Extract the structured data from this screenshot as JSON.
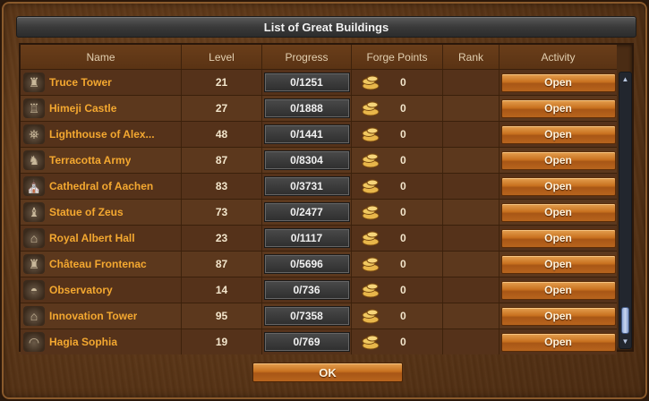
{
  "dialog": {
    "title": "List of Great Buildings",
    "ok_label": "OK"
  },
  "columns": {
    "name": "Name",
    "level": "Level",
    "progress": "Progress",
    "forge_points": "Forge Points",
    "rank": "Rank",
    "activity": "Activity"
  },
  "buildings": [
    {
      "name": "Truce Tower",
      "level": "21",
      "progress": "0/1251",
      "forge_points": "0",
      "rank": "",
      "action": "Open",
      "icon": "tower-icon"
    },
    {
      "name": "Himeji Castle",
      "level": "27",
      "progress": "0/1888",
      "forge_points": "0",
      "rank": "",
      "action": "Open",
      "icon": "castle-icon"
    },
    {
      "name": "Lighthouse of Alex...",
      "level": "48",
      "progress": "0/1441",
      "forge_points": "0",
      "rank": "",
      "action": "Open",
      "icon": "lighthouse-icon"
    },
    {
      "name": "Terracotta Army",
      "level": "87",
      "progress": "0/8304",
      "forge_points": "0",
      "rank": "",
      "action": "Open",
      "icon": "army-icon"
    },
    {
      "name": "Cathedral of Aachen",
      "level": "83",
      "progress": "0/3731",
      "forge_points": "0",
      "rank": "",
      "action": "Open",
      "icon": "cathedral-icon"
    },
    {
      "name": "Statue of Zeus",
      "level": "73",
      "progress": "0/2477",
      "forge_points": "0",
      "rank": "",
      "action": "Open",
      "icon": "statue-icon"
    },
    {
      "name": "Royal Albert Hall",
      "level": "23",
      "progress": "0/1117",
      "forge_points": "0",
      "rank": "",
      "action": "Open",
      "icon": "hall-icon"
    },
    {
      "name": "Château Frontenac",
      "level": "87",
      "progress": "0/5696",
      "forge_points": "0",
      "rank": "",
      "action": "Open",
      "icon": "chateau-icon"
    },
    {
      "name": "Observatory",
      "level": "14",
      "progress": "0/736",
      "forge_points": "0",
      "rank": "",
      "action": "Open",
      "icon": "observatory-icon"
    },
    {
      "name": "Innovation Tower",
      "level": "95",
      "progress": "0/7358",
      "forge_points": "0",
      "rank": "",
      "action": "Open",
      "icon": "innovation-tower-icon"
    },
    {
      "name": "Hagia Sophia",
      "level": "19",
      "progress": "0/769",
      "forge_points": "0",
      "rank": "",
      "action": "Open",
      "icon": "mosque-icon"
    }
  ],
  "icons": {
    "forge_point": "forge-points-icon",
    "scroll_up": "scroll-up-arrow-icon",
    "scroll_down": "scroll-down-arrow-icon"
  },
  "colors": {
    "building_name": "#f4a830",
    "button_orange": "#c8711f",
    "panel_brown": "#4a2c14",
    "title_bar": "#3a3a3a"
  }
}
